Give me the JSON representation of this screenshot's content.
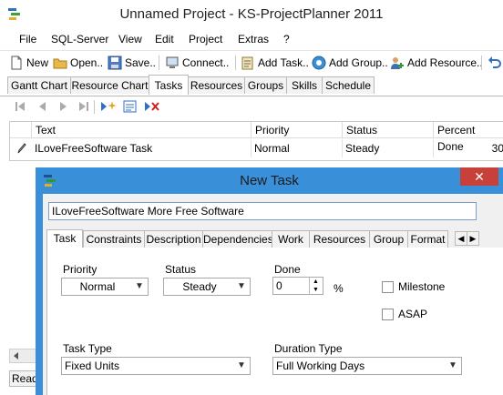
{
  "window": {
    "title": "Unnamed Project - KS-ProjectPlanner 2011"
  },
  "menu": [
    "File",
    "SQL-Server",
    "View",
    "Edit",
    "Project",
    "Extras",
    "?"
  ],
  "toolbar": {
    "new_label": "New",
    "open_label": "Open..",
    "save_label": "Save..",
    "connect_label": "Connect..",
    "add_task_label": "Add Task..",
    "add_group_label": "Add Group..",
    "add_resource_label": "Add Resource.."
  },
  "main_tabs": [
    "Gantt Chart",
    "Resource Chart",
    "Tasks",
    "Resources",
    "Groups",
    "Skills",
    "Schedule"
  ],
  "grid": {
    "columns": [
      "Text",
      "Priority",
      "Status",
      "Percent Done"
    ],
    "rows": [
      {
        "text": "ILoveFreeSoftware Task",
        "priority": "Normal",
        "status": "Steady",
        "percent": "30"
      }
    ]
  },
  "statusbar": {
    "text": "Read"
  },
  "dialog": {
    "title": "New Task",
    "close_glyph": "✕",
    "name_value": "ILoveFreeSoftware More Free Software",
    "tabs": [
      "Task",
      "Constraints",
      "Description",
      "Dependencies",
      "Work",
      "Resources",
      "Group",
      "Format"
    ],
    "priority_label": "Priority",
    "priority_value": "Normal",
    "status_label": "Status",
    "status_value": "Steady",
    "done_label": "Done",
    "done_value": "0",
    "percent_sign": "%",
    "milestone_label": "Milestone",
    "asap_label": "ASAP",
    "task_type_label": "Task Type",
    "task_type_value": "Fixed Units",
    "duration_type_label": "Duration Type",
    "duration_type_value": "Full Working Days"
  },
  "colors": {
    "dialog_frame": "#3a8fd9",
    "close_button": "#c7403a"
  },
  "icons": [
    "app-icon",
    "new-file-icon",
    "open-folder-icon",
    "save-icon",
    "connect-icon",
    "add-task-icon",
    "add-group-icon",
    "add-resource-icon",
    "undo-icon"
  ]
}
